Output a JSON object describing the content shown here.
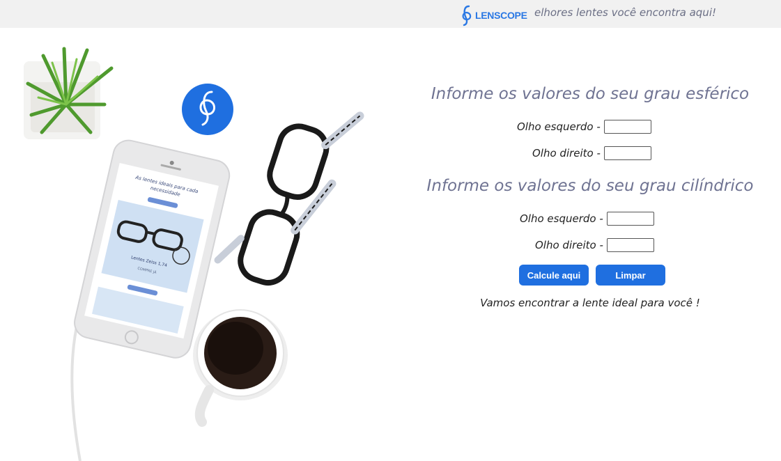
{
  "header": {
    "brand_name": "LENSCOPE",
    "tagline": "As melhores lentes você encontra aqui!",
    "accent_color": "#2a78e4"
  },
  "form": {
    "spherical_title": "Informe os valores do seu grau esférico",
    "cylindrical_title": "Informe os valores do seu grau cilíndrico",
    "left_eye_label": "Olho esquerdo -",
    "right_eye_label": "Olho direito -",
    "spherical_left_value": "",
    "spherical_right_value": "",
    "cylindrical_left_value": "",
    "cylindrical_right_value": "",
    "calculate_label": "Calcule aqui",
    "clear_label": "Limpar",
    "footer_text": "Vamos encontrar a lente ideal para você !"
  },
  "hero": {
    "icons": [
      "plant-image",
      "logo-badge",
      "smartphone-image",
      "glasses-image",
      "coffee-cup-image"
    ],
    "phone_screen_text": "As lentes ideais para cada necessidade"
  },
  "colors": {
    "button": "#1f6fe0",
    "heading": "#6f7392",
    "header_bg": "#f1f1f1"
  }
}
